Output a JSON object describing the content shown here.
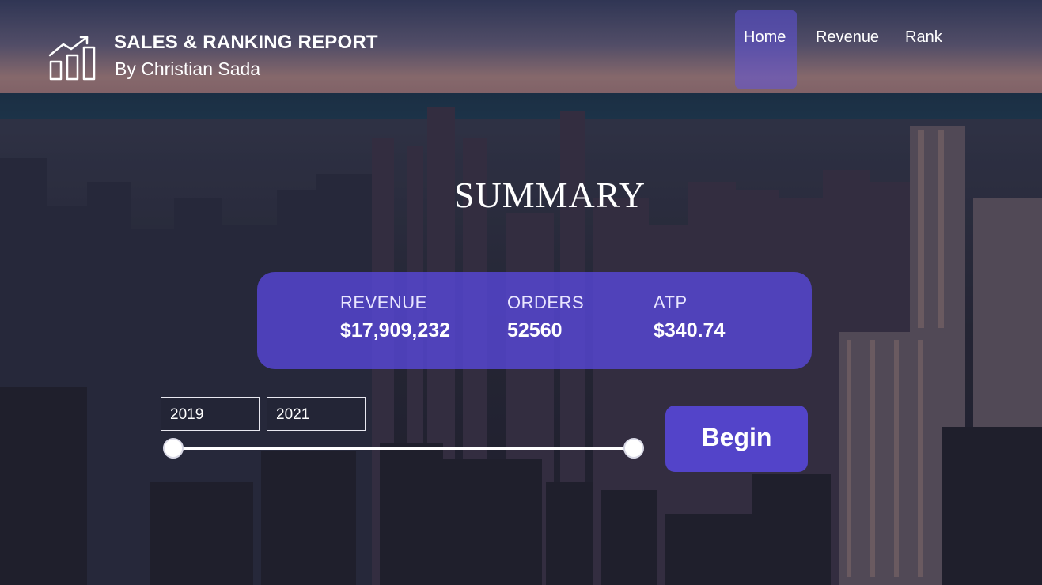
{
  "header": {
    "title": "SALES & RANKING REPORT",
    "subtitle": "By Christian Sada",
    "logo_icon": "bar-chart-growth-icon"
  },
  "nav": {
    "items": [
      {
        "label": "Home",
        "active": true
      },
      {
        "label": "Revenue",
        "active": false
      },
      {
        "label": "Rank",
        "active": false
      }
    ]
  },
  "summary": {
    "heading": "SUMMARY",
    "kpis": [
      {
        "label": "REVENUE",
        "value": "$17,909,232"
      },
      {
        "label": "ORDERS",
        "value": "52560"
      },
      {
        "label": "ATP",
        "value": "$340.74"
      }
    ]
  },
  "date_slicer": {
    "start": "2019",
    "end": "2021",
    "range_fraction": [
      0.0,
      1.0
    ]
  },
  "begin_button": {
    "label": "Begin"
  },
  "colors": {
    "accent": "#5848dc",
    "text": "#ffffff"
  }
}
